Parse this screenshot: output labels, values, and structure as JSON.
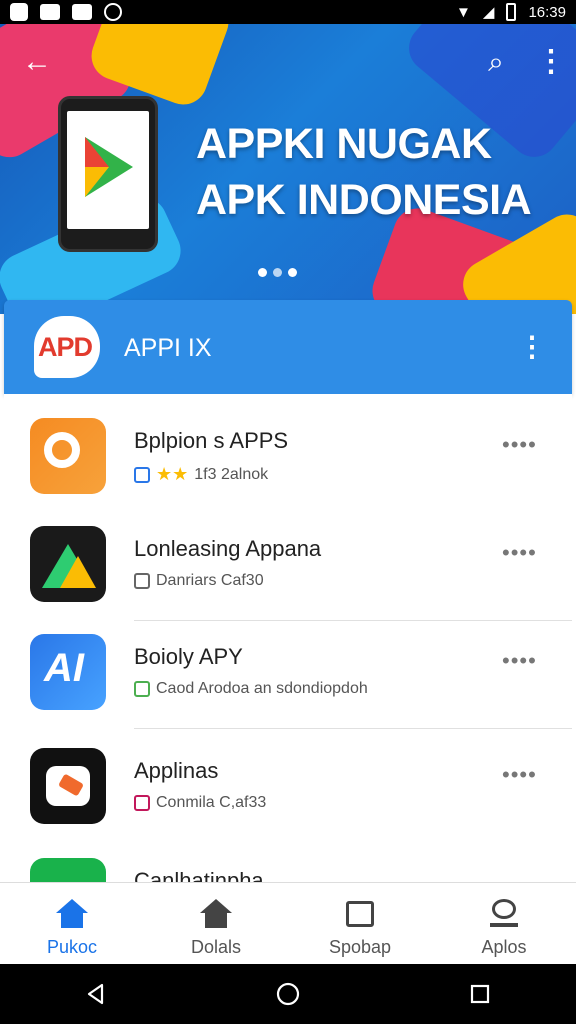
{
  "status": {
    "time": "16:39",
    "icons": [
      "notification-icon",
      "image-icon",
      "mail-icon",
      "settings-icon",
      "wifi-icon",
      "signal-icon",
      "battery-icon"
    ]
  },
  "banner": {
    "headline_line1": "APPKI NUGAK",
    "headline_line2": "APK INDONESIA",
    "dots": 3,
    "active_dot": 1
  },
  "appbar": {
    "logo_text": "APD",
    "title": "APPI IX"
  },
  "items": [
    {
      "name": "Bplpion s APPS",
      "sub": "1f3 2alnok",
      "icon_colors": [
        "#f58b22",
        "#fbbc04"
      ]
    },
    {
      "name": "Lonleasing Appana",
      "sub": "Danriars Caf30",
      "icon_colors": [
        "#111",
        "#2ecc71"
      ]
    },
    {
      "name": "Boioly APY",
      "sub": "Caod Arodoa an sdondiopdoh",
      "icon_colors": [
        "#2a77e8",
        "#47a2ff"
      ]
    },
    {
      "name": "Applinas",
      "sub": "Conmila C,af33",
      "icon_colors": [
        "#111",
        "#f06a2d"
      ]
    },
    {
      "name": "Canlhatinpha",
      "sub": "",
      "icon_colors": [
        "#19b24b",
        "#eee"
      ]
    }
  ],
  "bottom_nav": [
    {
      "label": "Pukoc",
      "icon": "home-icon",
      "active": true
    },
    {
      "label": "Dolals",
      "icon": "building-icon",
      "active": false
    },
    {
      "label": "Spobap",
      "icon": "chat-icon",
      "active": false
    },
    {
      "label": "Aplos",
      "icon": "person-icon",
      "active": false
    }
  ],
  "colors": {
    "accent": "#1a73e8",
    "appbar": "#2f8de6",
    "banner": "#1b7ed8"
  }
}
